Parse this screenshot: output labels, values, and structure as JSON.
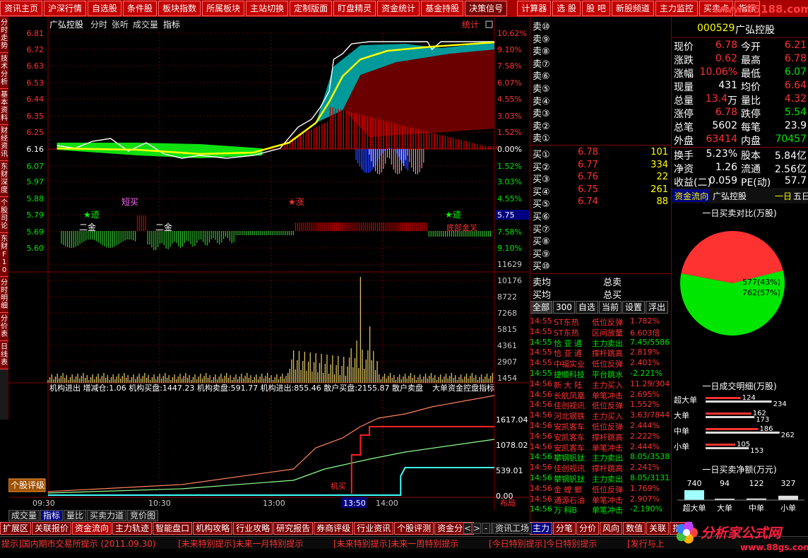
{
  "top_nav": [
    "资讯主页",
    "沪深行情",
    "自选股",
    "条件股",
    "板块指数",
    "所属板块",
    "主站切换",
    "定制版面",
    "盯盘精灵",
    "资金统计",
    "基金持股",
    "决策信号",
    "计算器",
    "选 股",
    "股 吧",
    "新股频道",
    "主力监控",
    "买卖点",
    "指标"
  ],
  "watermark": "www.85188.com",
  "left_tabs": [
    "分时走势",
    "技术分析",
    "基本资料",
    "财经资讯",
    "东财深度",
    "个股司论",
    "东财F10",
    "分时明细",
    "分价表",
    "日线表"
  ],
  "chart": {
    "title": "广弘控股",
    "tabs": [
      "分时",
      "张听",
      "成交量",
      "指标"
    ],
    "stat_btn": "统计",
    "prices": [
      "6.81",
      "6.72",
      "6.63",
      "6.53",
      "6.44",
      "6.35",
      "6.25",
      "6.16",
      "6.07",
      "5.97",
      "5.88",
      "5.79",
      "5.69",
      "5.60"
    ],
    "pcts_up": [
      "10.62%",
      "9.10%",
      "7.58%",
      "6.07%",
      "4.55%",
      "3.03%",
      "1.52%",
      "0.00%"
    ],
    "pcts_down": [
      "1.52%",
      "3.03%",
      "4.55%",
      "6.07%",
      "7.58%",
      "9.10%"
    ],
    "price_marker": "5.75",
    "volume_axis": [
      "11629",
      "10176",
      "8722",
      "7268",
      "5815",
      "4361",
      "2907",
      "1454"
    ],
    "annotations": {
      "short_buy": "短买",
      "up": "★涨",
      "chase1": "★迹",
      "chase2": "★迹",
      "two_gold1": "二金",
      "two_gold2": "二金",
      "bottom_label": "底部金叉"
    },
    "inst_line": "机构进出  增减仓:1.06  机构买盘:1447.23  机构卖盘:591.77  机构进出:855.46  散户买盘:2155.87  散户卖盘",
    "overlay_label": "大单资金控盘指标",
    "inst_axis": [
      "1617.04",
      "1078.02",
      "539.01",
      "0.00"
    ],
    "inst_tag": "机买",
    "rating_btn": "个股评级",
    "times": [
      "09:30",
      "10:30",
      "13:00",
      "13:50",
      "14:00"
    ],
    "layout_btn": "布局"
  },
  "stock": {
    "code": "000529",
    "name": "广弘控股",
    "rows": [
      {
        "l1": "现价",
        "v1": "6.78",
        "l2": "今开",
        "v2": "6.21"
      },
      {
        "l1": "涨跌",
        "v1": "0.62",
        "l2": "最高",
        "v2": "6.78"
      },
      {
        "l1": "涨幅",
        "v1": "10.06%",
        "l2": "最低",
        "v2": "6.07"
      },
      {
        "l1": "现量",
        "v1": "431",
        "l2": "均价",
        "v2": "6.64"
      },
      {
        "l1": "总量",
        "v1": "13.4",
        "u1": "万",
        "l2": "量比",
        "v2": "4.32"
      },
      {
        "l1": "涨停",
        "v1": "6.78",
        "l2": "跌停",
        "v2": "5.54"
      },
      {
        "l1": "总笔",
        "v1": "5602",
        "l2": "每笔",
        "v2": "23.9"
      },
      {
        "l1": "外盘",
        "v1": "63414",
        "l2": "内盘",
        "v2": "70457"
      }
    ],
    "rows2": [
      {
        "l1": "换手",
        "v1": "5.23%",
        "l2": "股本",
        "v2": "5.84亿"
      },
      {
        "l1": "净资",
        "v1": "1.26",
        "l2": "流通",
        "v2": "2.56亿"
      },
      {
        "l1": "收益(二)",
        "v1": "0.059",
        "l2": "PE(动)",
        "v2": "57.7"
      }
    ]
  },
  "order_book": {
    "sells": [
      "卖⑩",
      "卖⑨",
      "卖⑧",
      "卖⑦",
      "卖⑥",
      "卖⑤",
      "卖④",
      "卖③",
      "卖②",
      "卖①"
    ],
    "buys": [
      {
        "label": "买①",
        "price": "6.78",
        "vol": "101"
      },
      {
        "label": "买②",
        "price": "6.77",
        "vol": "334"
      },
      {
        "label": "买③",
        "price": "6.76",
        "vol": "22"
      },
      {
        "label": "买④",
        "price": "6.75",
        "vol": "261"
      },
      {
        "label": "买⑤",
        "price": "6.74",
        "vol": "88"
      },
      {
        "label": "买⑥"
      },
      {
        "label": "买⑦"
      },
      {
        "label": "买⑧"
      },
      {
        "label": "买⑨"
      },
      {
        "label": "买⑩"
      }
    ],
    "sell_avg": "卖均",
    "buy_avg": "买均",
    "total_sell": "总卖",
    "total_buy": "总买"
  },
  "tick_filters": [
    "全部",
    "300",
    "自选",
    "当前",
    "设置",
    "浮出"
  ],
  "ticks": [
    {
      "time": "14:55",
      "name": "ST东热",
      "event": "低位反弹",
      "value": "1.782%",
      "color": "#ff3232"
    },
    {
      "time": "14:55",
      "name": "ST东热",
      "event": "区间放量",
      "value": "6.603倍",
      "color": "#ff3232"
    },
    {
      "time": "14:55",
      "name": "恰 亚 通",
      "event": "主力卖出",
      "value": "7.45/5586",
      "color": "#00e600"
    },
    {
      "time": "14:55",
      "name": "恰 亚 通",
      "event": "撑杆跳高",
      "value": "2.819%",
      "color": "#ff3232"
    },
    {
      "time": "14:55",
      "name": "中福实业",
      "event": "低位反弹",
      "value": "2.401%",
      "color": "#ff3232"
    },
    {
      "time": "14:55",
      "name": "捷顺科技",
      "event": "平台跳水",
      "value": "-2.221%",
      "color": "#00e600"
    },
    {
      "time": "14:56",
      "name": "新 大 陆",
      "event": "主力买入",
      "value": "11.29/304",
      "color": "#ff3232"
    },
    {
      "time": "14:56",
      "name": "长航凤凰",
      "event": "单笔冲击",
      "value": "2.695%",
      "color": "#ff3232"
    },
    {
      "time": "14:56",
      "name": "佳创视讯",
      "event": "低位反弹",
      "value": "1.552%",
      "color": "#ff3232"
    },
    {
      "time": "14:56",
      "name": "河北钢铁",
      "event": "主力买入",
      "value": "3.63/7844",
      "color": "#ff3232"
    },
    {
      "time": "14:56",
      "name": "安凯客车",
      "event": "低位反弹",
      "value": "2.444%",
      "color": "#ff3232"
    },
    {
      "time": "14:56",
      "name": "安凯客车",
      "event": "撑杆跳高",
      "value": "2.222%",
      "color": "#ff3232"
    },
    {
      "time": "14:56",
      "name": "安凯客车",
      "event": "单笔冲击",
      "value": "2.444%",
      "color": "#ff3232"
    },
    {
      "time": "14:56",
      "name": "攀钢钒钛",
      "event": "主力卖出",
      "value": "8.05/3538",
      "color": "#00e600"
    },
    {
      "time": "14:56",
      "name": "佳创视讯",
      "event": "撑杆跳高",
      "value": "2.241%",
      "color": "#ff3232"
    },
    {
      "time": "14:56",
      "name": "攀钢钒钛",
      "event": "主力卖出",
      "value": "8.05/3131",
      "color": "#00e600"
    },
    {
      "time": "14:56",
      "name": "金 螳 螂",
      "event": "低位反弹",
      "value": "1.769%",
      "color": "#ff3232"
    },
    {
      "time": "14:56",
      "name": "通源石油",
      "event": "单笔冲击",
      "value": "2.907%",
      "color": "#ff3232"
    },
    {
      "time": "14:56",
      "name": "万 科B",
      "event": "单笔冲击",
      "value": "-2.190%",
      "color": "#00e600"
    }
  ],
  "fund_flow": {
    "tab": "资金流向",
    "name": "广弘控股",
    "day1": "一日",
    "day5": "五日",
    "pie_title": "一日买卖对比(万股)",
    "detail_title": "一日成交明细(万股)",
    "net_title": "一日买卖净额(万元)",
    "detail_labels": [
      "超大单",
      "大单",
      "中单",
      "小单"
    ]
  },
  "chart_data": [
    {
      "type": "pie",
      "title": "一日买卖对比(万股)",
      "labels": [
        "577(43%)",
        "762(57%)"
      ],
      "values": [
        577,
        762
      ],
      "colors": [
        "#ff3232",
        "#00e600"
      ]
    },
    {
      "type": "bar",
      "title": "一日成交明细(万股)",
      "categories": [
        "超大单",
        "大单",
        "中单",
        "小单"
      ],
      "series": [
        {
          "values": [
            124,
            162,
            186,
            105
          ]
        },
        {
          "values": [
            234,
            173,
            262,
            153
          ]
        }
      ],
      "labels": [
        [
          "124",
          "234"
        ],
        [
          "162",
          "173"
        ],
        [
          "186",
          "262"
        ],
        [
          "105",
          "153"
        ]
      ]
    },
    {
      "type": "bar",
      "title": "一日买卖净额(万元)",
      "categories": [
        "超大单",
        "大单",
        "中单",
        "小单"
      ],
      "values": [
        740,
        94,
        122,
        327
      ]
    }
  ],
  "bottom_tabs_chart": [
    "成交量",
    "指标",
    "量比",
    "买卖力道",
    "竞价图"
  ],
  "bottom_tabs_main": [
    "扩展区",
    "关联报价",
    "资金流向",
    "主力轨迹",
    "智能盘口",
    "机构攻略",
    "行业攻略",
    "研究报告",
    "券商评级",
    "行业资讯",
    "个股评测",
    "资金分布"
  ],
  "bottom_nav_arrows": [
    "<",
    ">",
    "-",
    "+"
  ],
  "info_btn": "资讯工场",
  "right_tabs": [
    "主力",
    "分笔",
    "分价",
    "风向",
    "数值",
    "关联",
    "指标"
  ],
  "ticker": [
    "提示]国内期市交易所提示 (2011.09.30)",
    "[未来特别提示]未来一月特别提示",
    "[未来特别提示]未来一周特别提示",
    "[今日特别提示]今日特别提示",
    "[发行与上"
  ],
  "logo_text": "分析家公式网",
  "logo_url": "www.88gs.com"
}
